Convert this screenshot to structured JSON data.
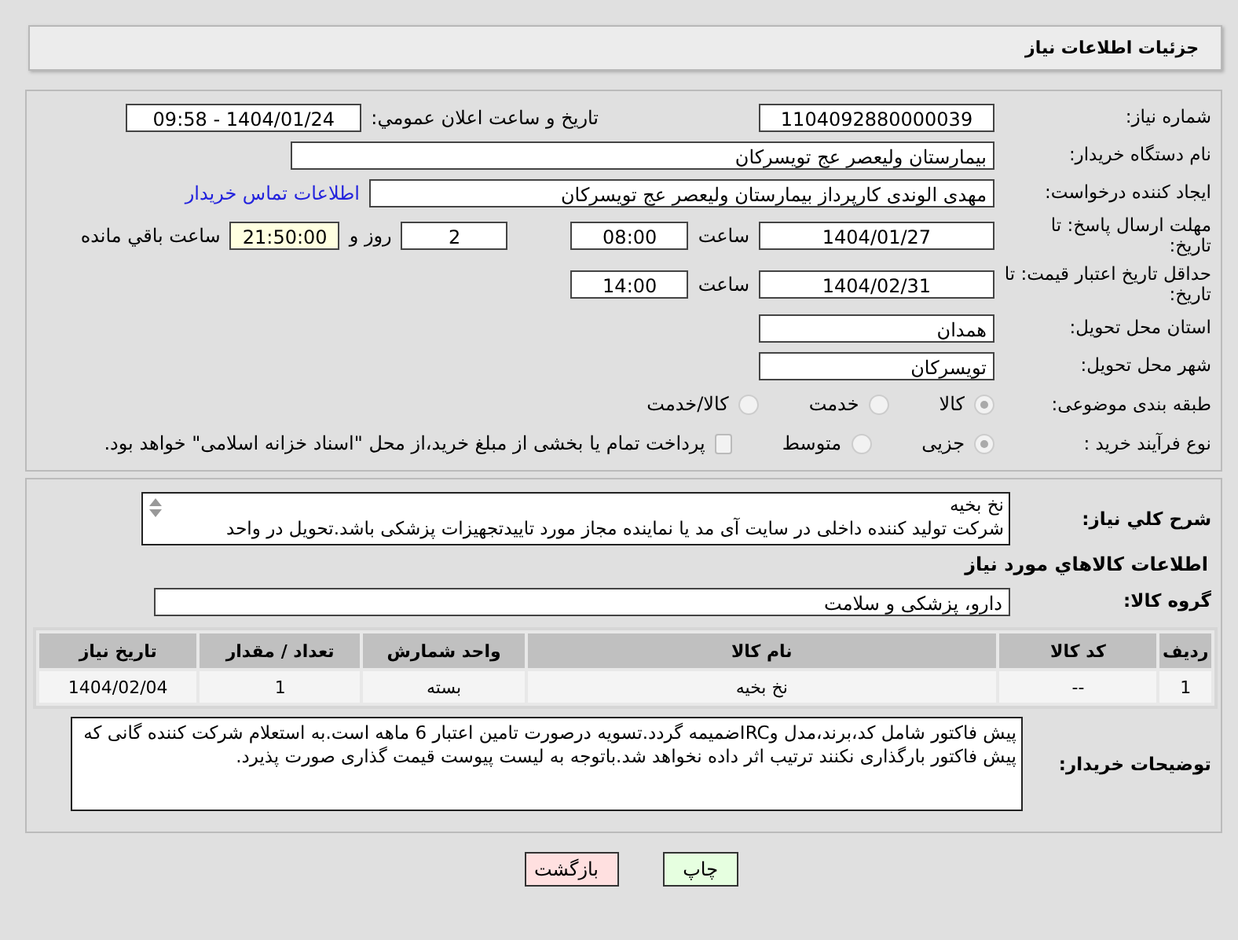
{
  "page_title": "جزئیات اطلاعات نیاز",
  "need_number": {
    "label": "شماره نیاز:",
    "value": "1104092880000039"
  },
  "announce": {
    "label": "تاریخ و ساعت اعلان عمومي:",
    "value": "1404/01/24 - 09:58"
  },
  "buyer_org": {
    "label": "نام دستگاه خریدار:",
    "value": "بیمارستان ولیعصر  عج  تویسرکان"
  },
  "requester": {
    "label": "ایجاد کننده درخواست:",
    "value": "مهدی الوندی کارپرداز بیمارستان ولیعصر  عج  تویسرکان",
    "link": "اطلاعات تماس خریدار"
  },
  "reply_deadline": {
    "label": "مهلت ارسال پاسخ: تا تاریخ:",
    "date": "1404/01/27",
    "time_label": "ساعت",
    "time": "08:00",
    "days": "2",
    "days_label": "روز و",
    "remaining": "21:50:00",
    "remaining_label": "ساعت باقي مانده"
  },
  "price_validity": {
    "label": "حداقل تاریخ اعتبار قیمت: تا تاریخ:",
    "date": "1404/02/31",
    "time_label": "ساعت",
    "time": "14:00"
  },
  "province": {
    "label": "استان محل تحویل:",
    "value": "همدان"
  },
  "city": {
    "label": "شهر محل تحویل:",
    "value": "تویسرکان"
  },
  "category": {
    "label": "طبقه بندی موضوعی:",
    "options": [
      {
        "label": "کالا",
        "selected": true
      },
      {
        "label": "خدمت",
        "selected": false
      },
      {
        "label": "کالا/خدمت",
        "selected": false
      }
    ]
  },
  "process": {
    "label": "نوع فرآیند خرید :",
    "options": [
      {
        "label": "جزیی",
        "selected": true
      },
      {
        "label": "متوسط",
        "selected": false
      }
    ],
    "treasury": {
      "label": "پرداخت تمام یا بخشی از مبلغ خرید،از محل \"اسناد خزانه اسلامی\" خواهد بود.",
      "checked": false
    }
  },
  "description": {
    "label": "شرح کلي نياز:",
    "value": "نخ بخیه\nشرکت تولید کننده داخلی در سایت آی مد یا نماینده مجاز مورد تاییدتجهیزات پزشکی باشد.تحویل در واحد"
  },
  "goods_heading": "اطلاعات کالاهاي مورد نياز",
  "goods_group": {
    "label": "گروه کالا:",
    "value": "دارو، پزشکی و سلامت"
  },
  "table": {
    "columns": [
      "ردیف",
      "کد کالا",
      "نام کالا",
      "واحد شمارش",
      "تعداد / مقدار",
      "تاریخ نیاز"
    ],
    "rows": [
      [
        "1",
        "--",
        "نخ بخیه",
        "بسته",
        "1",
        "1404/02/04"
      ]
    ]
  },
  "buyer_notes": {
    "label": "توضیحات خریدار:",
    "value": "پیش فاکتور شامل کد،برند،مدل وIRCضمیمه گردد.تسویه درصورت تامین اعتبار 6 ماهه است.به استعلام شرکت کننده گانی که پیش فاکتور بارگذاری نکنند ترتیب اثر داده نخواهد شد.باتوجه به لیست پیوست قیمت گذاری صورت پذیرد."
  },
  "buttons": [
    {
      "label": "چاپ",
      "kind": "print"
    },
    {
      "label": "بازگشت",
      "kind": "back"
    }
  ]
}
